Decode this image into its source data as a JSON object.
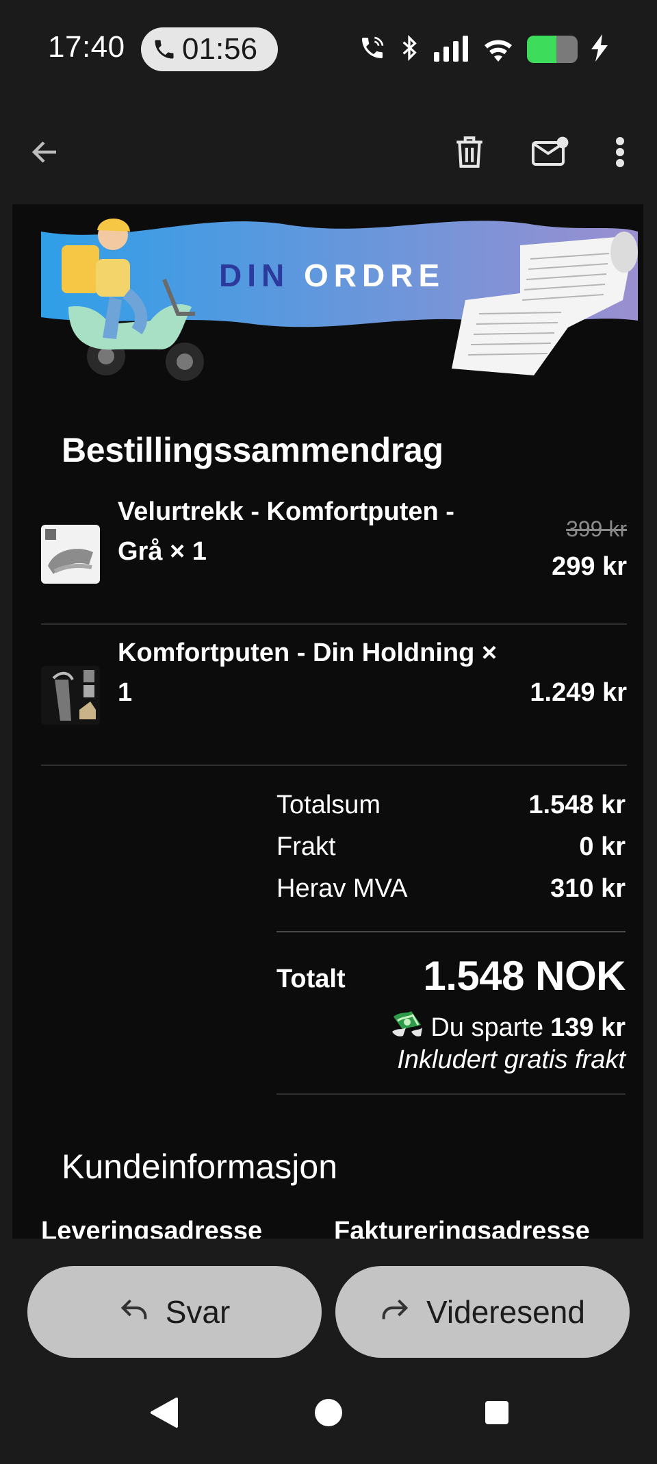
{
  "status_bar": {
    "time": "17:40",
    "call_duration": "01:56",
    "battery_level": 0.58
  },
  "toolbar": {
    "back_icon": "arrow-left-icon",
    "delete_icon": "trash-icon",
    "mark_unread_icon": "mail-unread-icon",
    "more_icon": "more-vert-icon"
  },
  "banner": {
    "text": "DIN ORDRE"
  },
  "order": {
    "title": "Bestillingssammendrag",
    "items": [
      {
        "name": "Velurtrekk - Komfortputen - Grå × 1",
        "old_price": "399 kr",
        "price": "299 kr"
      },
      {
        "name": "Komfortputen - Din Holdning × 1",
        "price": "1.249 kr"
      }
    ],
    "totals": [
      {
        "label": "Totalsum",
        "value": "1.548 kr"
      },
      {
        "label": "Frakt",
        "value": "0 kr"
      },
      {
        "label": "Herav MVA",
        "value": "310 kr"
      }
    ],
    "total_label": "Totalt",
    "total_value": "1.548 NOK",
    "saved_prefix": "Du sparte",
    "saved_amount": "139 kr",
    "free_shipping": "Inkludert gratis frakt"
  },
  "customer": {
    "title": "Kundeinformasjon",
    "delivery_label": "Leveringsadresse",
    "billing_label": "Faktureringsadresse"
  },
  "actions": {
    "reply": "Svar",
    "forward": "Videresend"
  },
  "colors": {
    "background": "#1b1b1c",
    "content_bg": "#0c0c0c",
    "button_bg": "#c4c4c4",
    "banner_gradient_start": "#2f9fe8",
    "banner_gradient_end": "#9a8fd0",
    "banner_text_dark": "#2b3a9c"
  }
}
